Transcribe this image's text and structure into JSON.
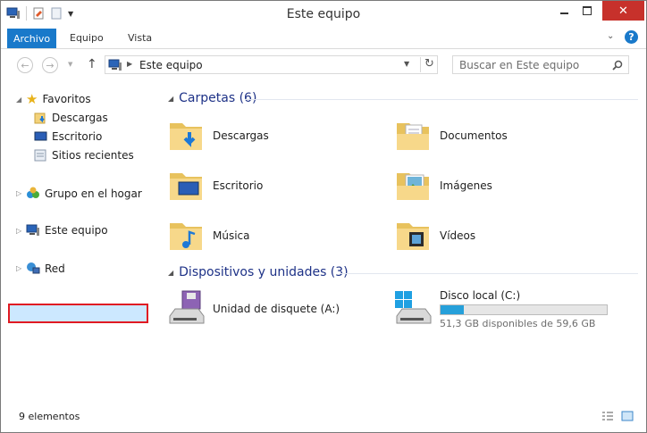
{
  "window": {
    "title": "Este equipo"
  },
  "ribbon": {
    "tabs": [
      {
        "label": "Archivo"
      },
      {
        "label": "Equipo"
      },
      {
        "label": "Vista"
      }
    ]
  },
  "address": {
    "path": "Este equipo",
    "search_placeholder": "Buscar en Este equipo"
  },
  "sidebar": {
    "favoritos": {
      "label": "Favoritos",
      "items": [
        {
          "label": "Descargas"
        },
        {
          "label": "Escritorio"
        },
        {
          "label": "Sitios recientes"
        }
      ]
    },
    "grupo": {
      "label": "Grupo en el hogar"
    },
    "equipo": {
      "label": "Este equipo"
    },
    "red": {
      "label": "Red"
    }
  },
  "main": {
    "folders_header": "Carpetas (6)",
    "folders": [
      {
        "label": "Descargas"
      },
      {
        "label": "Documentos"
      },
      {
        "label": "Escritorio"
      },
      {
        "label": "Imágenes"
      },
      {
        "label": "Música"
      },
      {
        "label": "Vídeos"
      }
    ],
    "devices_header": "Dispositivos y unidades (3)",
    "devices": [
      {
        "label": "Unidad de disquete (A:)"
      },
      {
        "label": "Disco local (C:)",
        "detail": "51,3 GB disponibles de 59,6 GB",
        "used_fraction": 0.14
      }
    ]
  },
  "status": {
    "count": "9 elementos"
  },
  "colors": {
    "accent": "#1979ca",
    "selection": "#cce8ff",
    "highlight_border": "#e01a22",
    "close_button": "#c7312b",
    "header_text": "#1e3287"
  }
}
